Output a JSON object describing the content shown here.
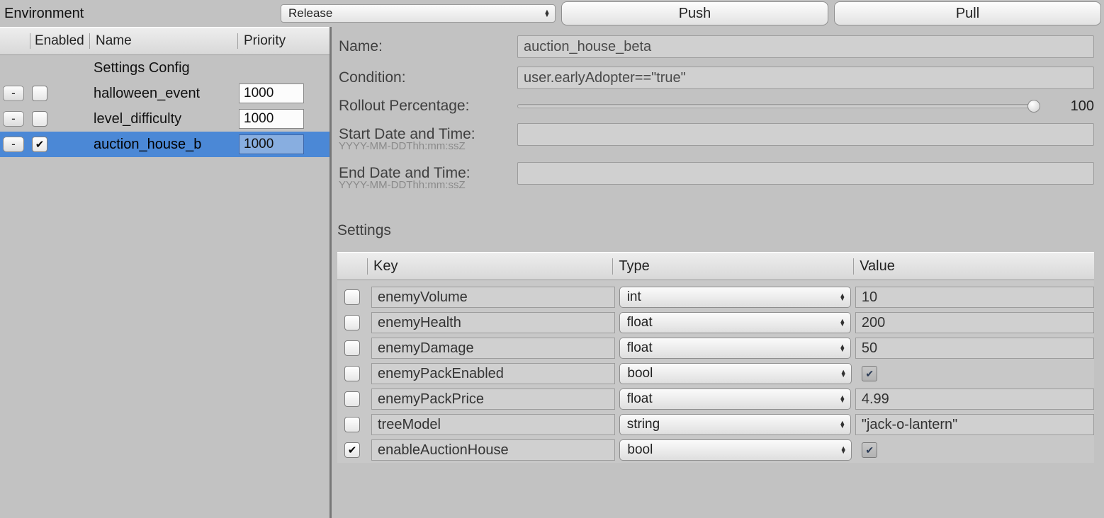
{
  "topbar": {
    "env_label": "Environment",
    "env_value": "Release",
    "push_label": "Push",
    "pull_label": "Pull"
  },
  "list": {
    "col_enabled": "Enabled",
    "col_name": "Name",
    "col_priority": "Priority",
    "group_label": "Settings Config",
    "rows": [
      {
        "name": "halloween_event",
        "priority": "1000",
        "checked": false,
        "selected": false
      },
      {
        "name": "level_difficulty",
        "priority": "1000",
        "checked": false,
        "selected": false
      },
      {
        "name": "auction_house_b",
        "priority": "1000",
        "checked": true,
        "selected": true
      }
    ]
  },
  "form": {
    "name_label": "Name:",
    "name_value": "auction_house_beta",
    "condition_label": "Condition:",
    "condition_value": "user.earlyAdopter==\"true\"",
    "rollout_label": "Rollout Percentage:",
    "rollout_value": "100",
    "rollout_percent": 100,
    "start_label": "Start Date and Time:",
    "start_hint": "YYYY-MM-DDThh:mm:ssZ",
    "start_value": "",
    "end_label": "End Date and Time:",
    "end_hint": "YYYY-MM-DDThh:mm:ssZ",
    "end_value": ""
  },
  "settings": {
    "title": "Settings",
    "col_key": "Key",
    "col_type": "Type",
    "col_value": "Value",
    "rows": [
      {
        "row_checked": false,
        "key": "enemyVolume",
        "type": "int",
        "value": "10",
        "bool_on": false
      },
      {
        "row_checked": false,
        "key": "enemyHealth",
        "type": "float",
        "value": "200",
        "bool_on": false
      },
      {
        "row_checked": false,
        "key": "enemyDamage",
        "type": "float",
        "value": "50",
        "bool_on": false
      },
      {
        "row_checked": false,
        "key": "enemyPackEnabled",
        "type": "bool",
        "value": "",
        "bool_on": true
      },
      {
        "row_checked": false,
        "key": "enemyPackPrice",
        "type": "float",
        "value": "4.99",
        "bool_on": false
      },
      {
        "row_checked": false,
        "key": "treeModel",
        "type": "string",
        "value": "\"jack-o-lantern\"",
        "bool_on": false
      },
      {
        "row_checked": true,
        "key": "enableAuctionHouse",
        "type": "bool",
        "value": "",
        "bool_on": true
      }
    ]
  }
}
